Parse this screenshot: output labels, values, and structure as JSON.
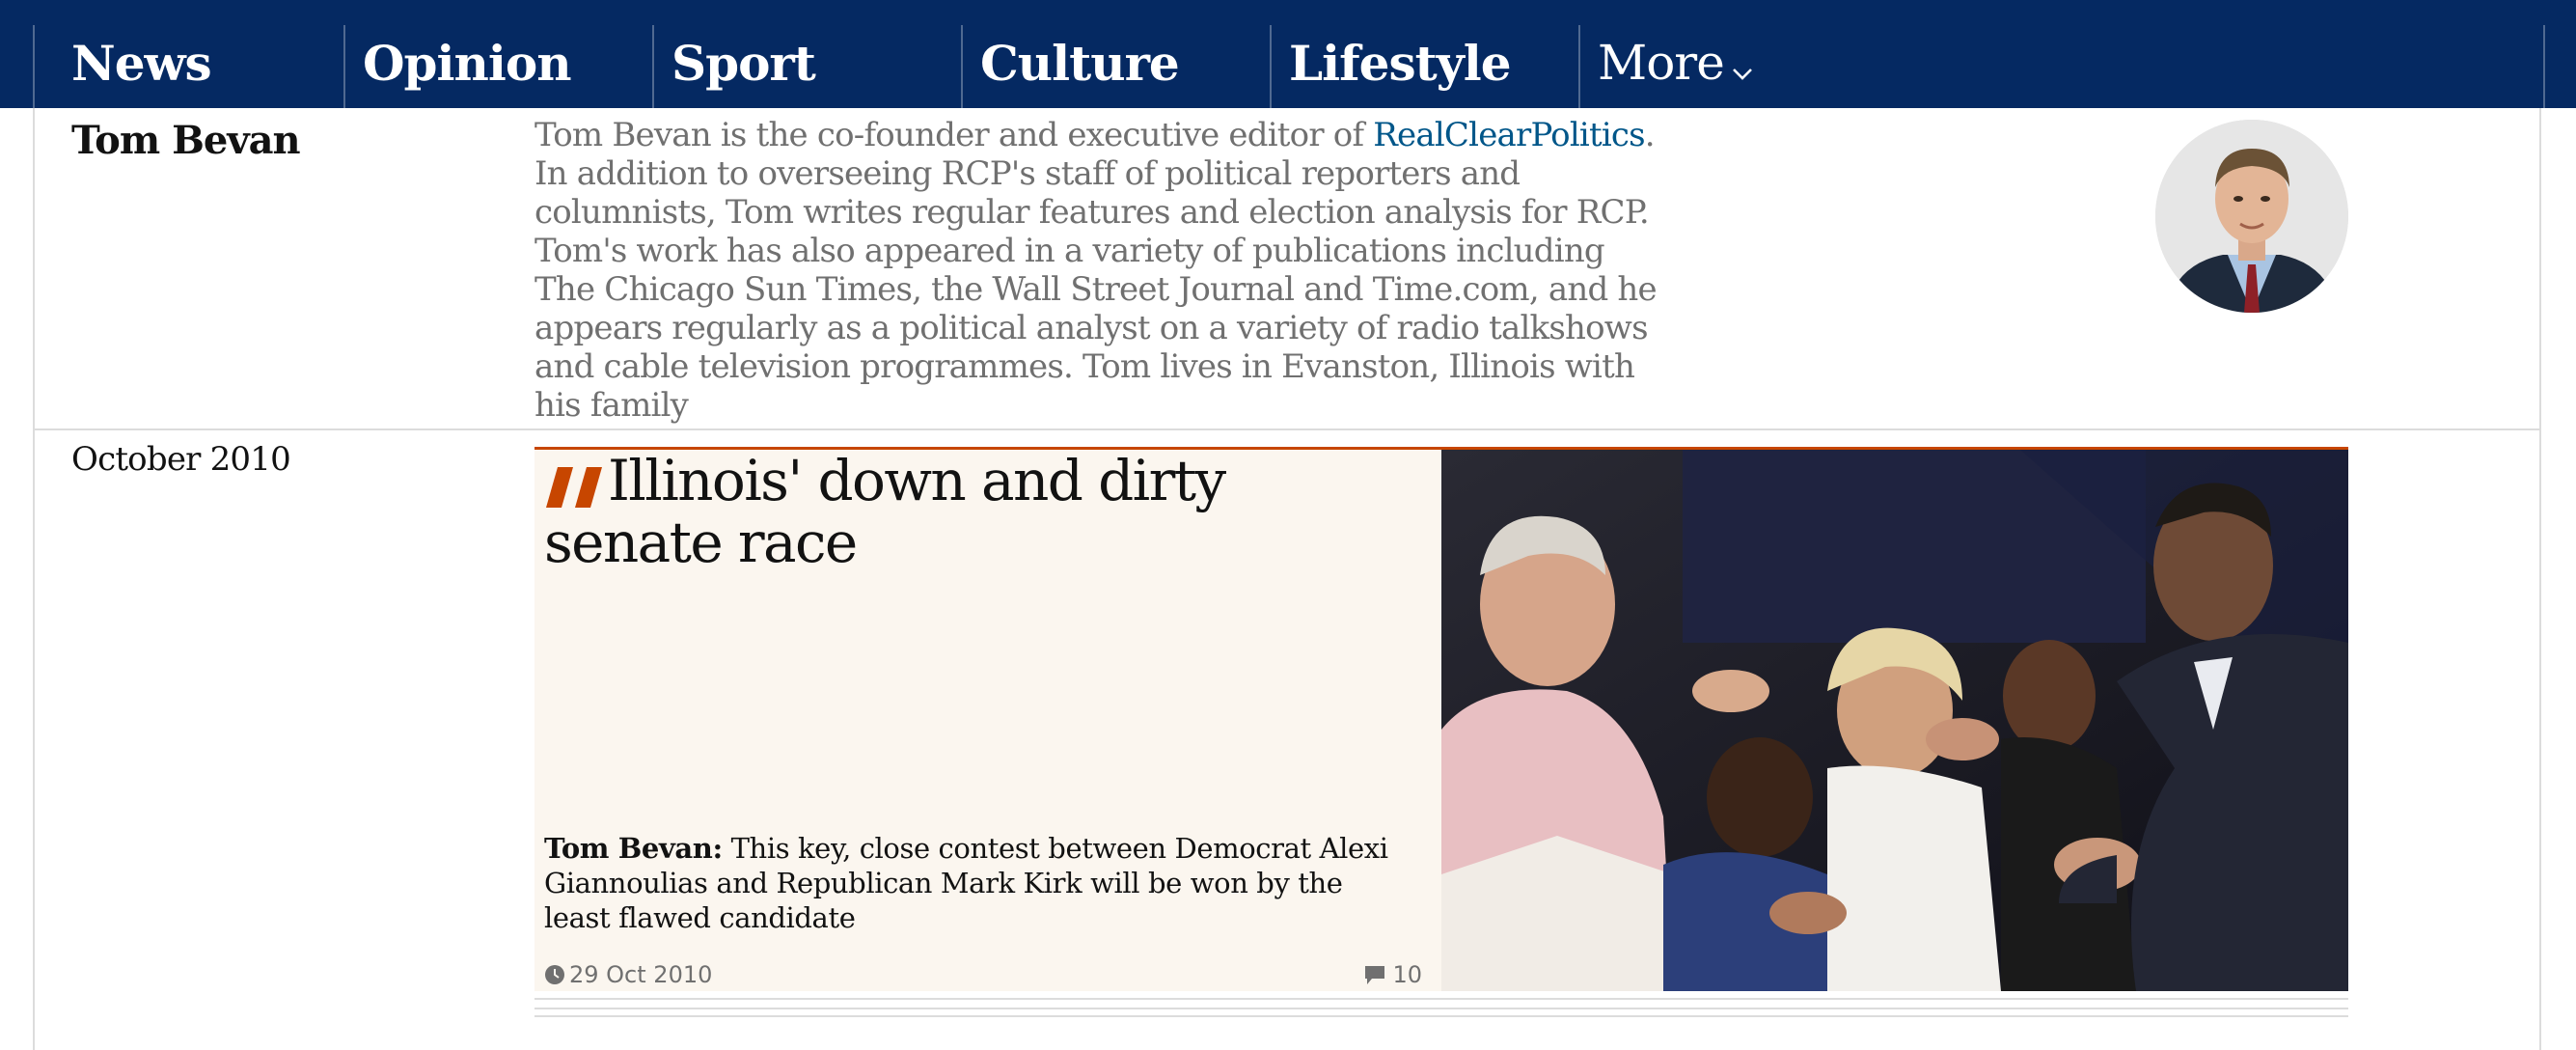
{
  "nav": {
    "items": [
      "News",
      "Opinion",
      "Sport",
      "Culture",
      "Lifestyle"
    ],
    "more_label": "More"
  },
  "profile": {
    "name": "Tom Bevan",
    "bio_before_link": "Tom Bevan is the co-founder and executive editor of ",
    "bio_link": "RealClearPolitics",
    "bio_after_link": ". In addition to overseeing RCP's staff of political reporters and columnists, Tom writes regular features and election analysis for RCP. Tom's work has also appeared in a variety of publications including The Chicago Sun Times, the Wall Street Journal and Time.com, and he appears regularly as a political analyst on a variety of radio talkshows and cable television programmes. Tom lives in Evanston, Illinois with his family"
  },
  "section": {
    "date_label": "October 2010"
  },
  "article": {
    "headline": "Illinois' down and dirty senate race",
    "byline": "Tom Bevan:",
    "standfirst": "This key, close contest between Democrat Alexi Giannoulias and Republican Mark Kirk will be won by the least flawed candidate",
    "date": "29 Oct 2010",
    "comment_count": "10"
  },
  "colors": {
    "brand_navy": "#052962",
    "accent_orange": "#c74600",
    "link_blue": "#005689",
    "card_background": "#fbf6ef"
  },
  "icons": [
    "chevron-down-icon",
    "quote-icon",
    "clock-icon",
    "comment-icon"
  ]
}
